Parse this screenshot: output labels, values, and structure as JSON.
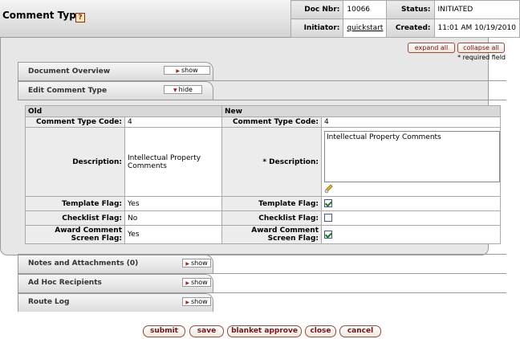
{
  "header": {
    "title": "Comment Type",
    "help_icon": "?",
    "doc_nbr_label": "Doc Nbr:",
    "doc_nbr": "10066",
    "status_label": "Status:",
    "status": "INITIATED",
    "initiator_label": "Initiator:",
    "initiator": "quickstart",
    "created_label": "Created:",
    "created": "11:01 AM 10/19/2010"
  },
  "toolbar": {
    "expand_all": "expand all",
    "collapse_all": "collapse all",
    "required_note": "* required field"
  },
  "tabs": {
    "document_overview": {
      "label": "Document Overview",
      "button": "show"
    },
    "edit_comment_type": {
      "label": "Edit Comment Type",
      "button": "hide"
    },
    "notes_attachments": {
      "label": "Notes and Attachments (0)",
      "button": "show"
    },
    "ad_hoc": {
      "label": "Ad Hoc Recipients",
      "button": "show"
    },
    "route_log": {
      "label": "Route Log",
      "button": "show"
    }
  },
  "edit": {
    "old_header": "Old",
    "new_header": "New",
    "code_label": "Comment Type Code:",
    "old_code": "4",
    "new_code": "4",
    "old_desc_label": "Description:",
    "new_desc_label": "*  Description:",
    "old_description": "Intellectual Property Comments",
    "new_description": "Intellectual Property Comments",
    "template_label": "Template Flag:",
    "old_template": "Yes",
    "new_template": true,
    "checklist_label": "Checklist Flag:",
    "old_checklist": "No",
    "new_checklist": false,
    "award_label_1": "Award Comment",
    "award_label_2": "Screen Flag:",
    "old_award": "Yes",
    "new_award": true
  },
  "actions": {
    "submit": "submit",
    "save": "save",
    "blanket_approve": "blanket approve",
    "close": "close",
    "cancel": "cancel"
  },
  "colors": {
    "button_text": "#771111",
    "button_border": "#9a4a3a",
    "checkbox_check": "#1d7a1d"
  }
}
